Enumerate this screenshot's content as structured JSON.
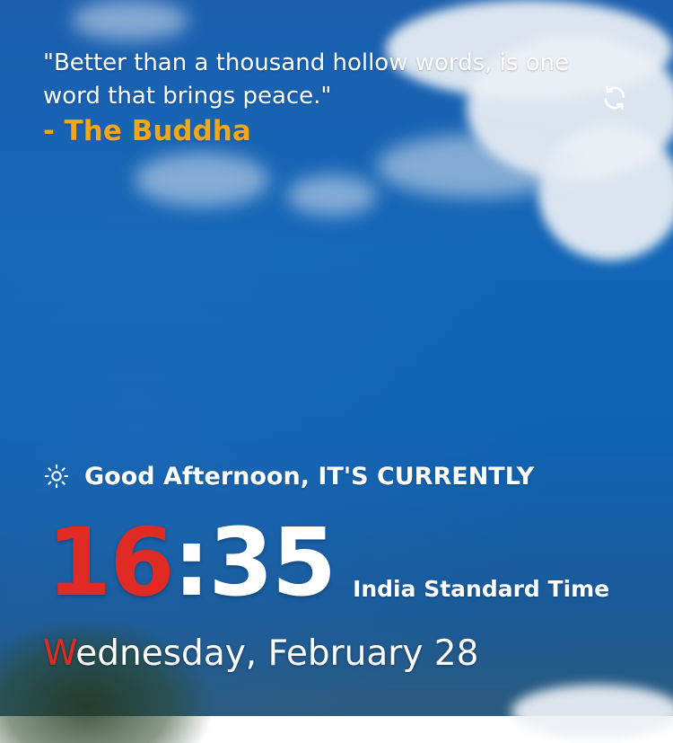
{
  "quote": {
    "text": "\"Better than a thousand hollow words, is one word that brings peace.\"",
    "author": "- The Buddha"
  },
  "controls": {
    "refresh_icon": "refresh-icon"
  },
  "greeting": {
    "icon": "sun-icon",
    "text": "Good Afternoon, IT'S CURRENTLY"
  },
  "clock": {
    "hour": "16",
    "separator": ":",
    "minute": "35",
    "timezone": "India Standard Time"
  },
  "date": {
    "first_letter": "W",
    "rest": "ednesday, February 28"
  },
  "colors": {
    "accent_red": "#e02a24",
    "author_gold": "#f0a719",
    "text": "#ffffff",
    "sky": "#1467b8"
  }
}
